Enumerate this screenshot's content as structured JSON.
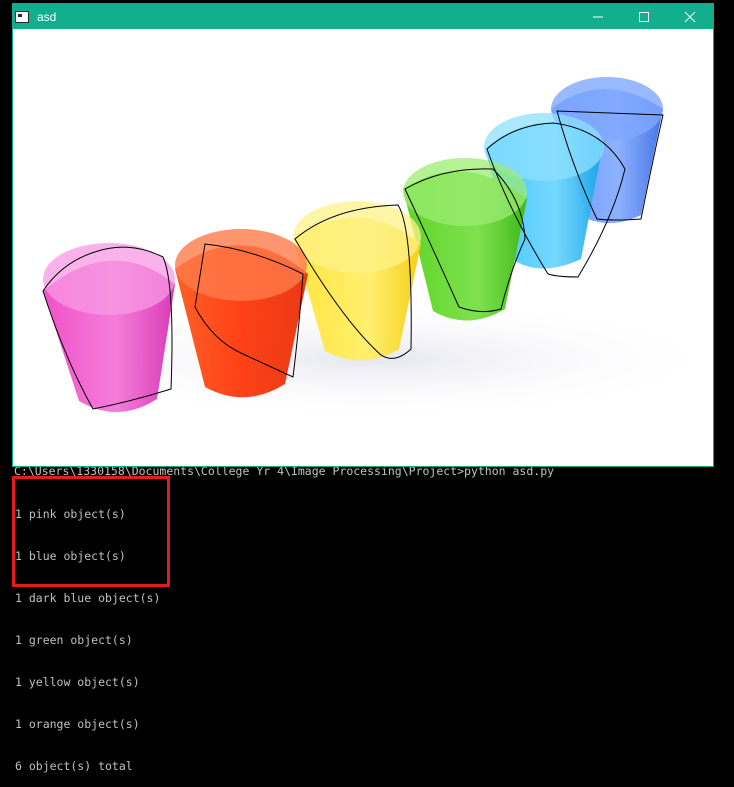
{
  "window": {
    "title": "asd",
    "controls": {
      "minimize": "minimize-icon",
      "maximize": "maximize-icon",
      "close": "close-icon"
    },
    "accent_color": "#12af8f"
  },
  "console": {
    "command_line": "C:\\Users\\1330158\\Documents\\College Yr 4\\Image Processing\\Project>python asd.py",
    "output": [
      "1 pink object(s)",
      "1 blue object(s)",
      "1 dark blue object(s)",
      "1 green object(s)",
      "1 yellow object(s)",
      "1 orange object(s)",
      "6 object(s) total"
    ],
    "highlight_color": "#e01c1c"
  },
  "image": {
    "cups": [
      {
        "name": "pink",
        "color": "#f04cc8"
      },
      {
        "name": "orange",
        "color": "#ff4a12"
      },
      {
        "name": "yellow",
        "color": "#ffe21a"
      },
      {
        "name": "green",
        "color": "#55d21e"
      },
      {
        "name": "blue",
        "color": "#1fb6f5"
      },
      {
        "name": "dark blue",
        "color": "#4a7df2"
      }
    ]
  }
}
